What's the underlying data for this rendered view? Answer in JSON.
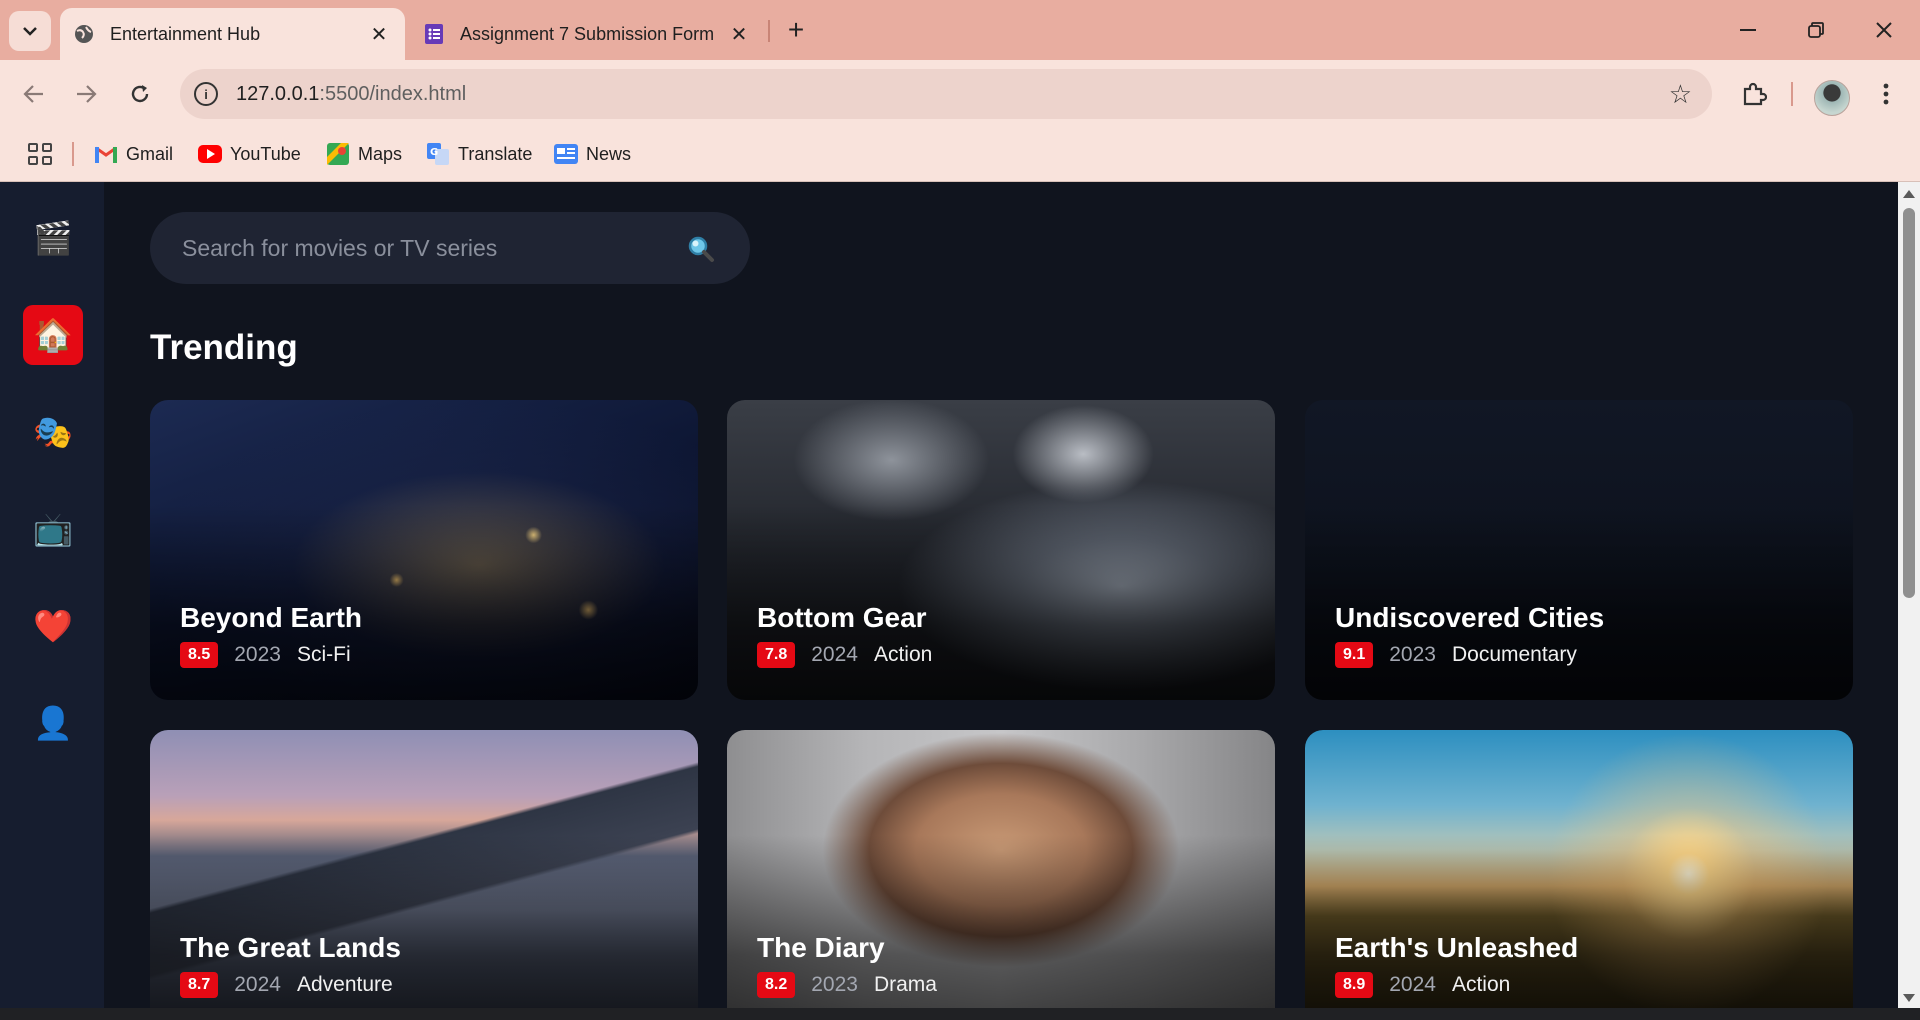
{
  "browser": {
    "tabs": [
      {
        "title": "Entertainment Hub",
        "icon": "globe-icon",
        "active": true
      },
      {
        "title": "Assignment 7 Submission Form",
        "icon": "forms-icon",
        "active": false
      }
    ],
    "url_host": "127.0.0.1",
    "url_path": ":5500/index.html",
    "bookmarks": [
      {
        "label": "Gmail",
        "icon": "gmail-icon"
      },
      {
        "label": "YouTube",
        "icon": "youtube-icon"
      },
      {
        "label": "Maps",
        "icon": "maps-icon"
      },
      {
        "label": "Translate",
        "icon": "translate-icon"
      },
      {
        "label": "News",
        "icon": "news-icon"
      }
    ]
  },
  "sidebar": {
    "items": [
      {
        "name": "logo",
        "glyph": "🎬"
      },
      {
        "name": "home",
        "glyph": "🏠",
        "active": true
      },
      {
        "name": "movies",
        "glyph": "🎭"
      },
      {
        "name": "tv-series",
        "glyph": "📺"
      },
      {
        "name": "favorites",
        "glyph": "❤️"
      },
      {
        "name": "profile",
        "glyph": "👤"
      }
    ]
  },
  "search": {
    "placeholder": "Search for movies or TV series"
  },
  "trending": {
    "title": "Trending",
    "cards": [
      {
        "title": "Beyond Earth",
        "rating": "8.5",
        "year": "2023",
        "genre": "Sci-Fi"
      },
      {
        "title": "Bottom Gear",
        "rating": "7.8",
        "year": "2024",
        "genre": "Action"
      },
      {
        "title": "Undiscovered Cities",
        "rating": "9.1",
        "year": "2023",
        "genre": "Documentary"
      },
      {
        "title": "The Great Lands",
        "rating": "8.7",
        "year": "2024",
        "genre": "Adventure"
      },
      {
        "title": "The Diary",
        "rating": "8.2",
        "year": "2023",
        "genre": "Drama"
      },
      {
        "title": "Earth's Unleashed",
        "rating": "8.9",
        "year": "2024",
        "genre": "Action"
      }
    ]
  },
  "colors": {
    "accent": "#e50914",
    "background": "#10141e",
    "sidebar": "#161d2f",
    "tabbar": "#e8ada0"
  }
}
